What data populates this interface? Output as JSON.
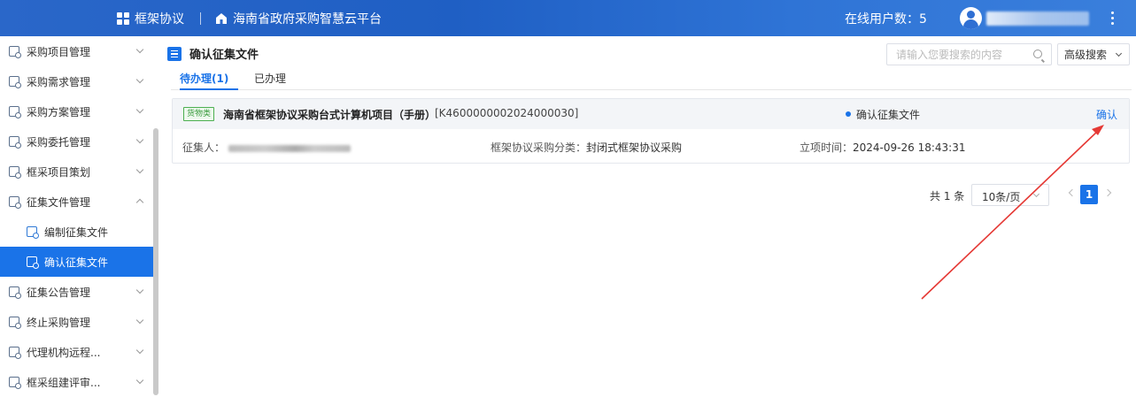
{
  "header": {
    "app_title": "框架协议",
    "platform_name": "海南省政府采购智慧云平台",
    "online_users": "在线用户数：5"
  },
  "sidebar": {
    "items": [
      {
        "label": "采购项目管理",
        "expanded": false
      },
      {
        "label": "采购需求管理",
        "expanded": false
      },
      {
        "label": "采购方案管理",
        "expanded": false
      },
      {
        "label": "采购委托管理",
        "expanded": false
      },
      {
        "label": "框采项目策划",
        "expanded": false
      },
      {
        "label": "征集文件管理",
        "expanded": true
      },
      {
        "label": "编制征集文件",
        "sub": true
      },
      {
        "label": "确认征集文件",
        "sub": true,
        "active": true
      },
      {
        "label": "征集公告管理",
        "expanded": false
      },
      {
        "label": "终止采购管理",
        "expanded": false
      },
      {
        "label": "代理机构远程...",
        "expanded": false
      },
      {
        "label": "框采组建评审...",
        "expanded": false
      }
    ]
  },
  "main": {
    "page_title": "确认征集文件",
    "search": {
      "placeholder": "请输入您要搜索的内容",
      "value": ""
    },
    "advanced_search": "高级搜索",
    "tabs": [
      {
        "label": "待办理(1)",
        "active": true
      },
      {
        "label": "已办理",
        "active": false
      }
    ],
    "record": {
      "tag": "货物类",
      "name": "海南省框架协议采购台式计算机项目（手册）",
      "code": "[K4600000002024000030]",
      "status": "确认征集文件",
      "action": "确认",
      "collector_label": "征集人：",
      "category_label": "框架协议采购分类：",
      "category_value": "封闭式框架协议采购",
      "time_label": "立项时间：",
      "time_value": "2024-09-26 18:43:31"
    },
    "pagination": {
      "total": "共 1 条",
      "page_size": "10条/页",
      "current_page": "1"
    }
  },
  "colors": {
    "primary": "#1a73e8",
    "header_bg": "#2a67c9",
    "tag_green": "#4caf50",
    "annotation_red": "#e53935"
  }
}
